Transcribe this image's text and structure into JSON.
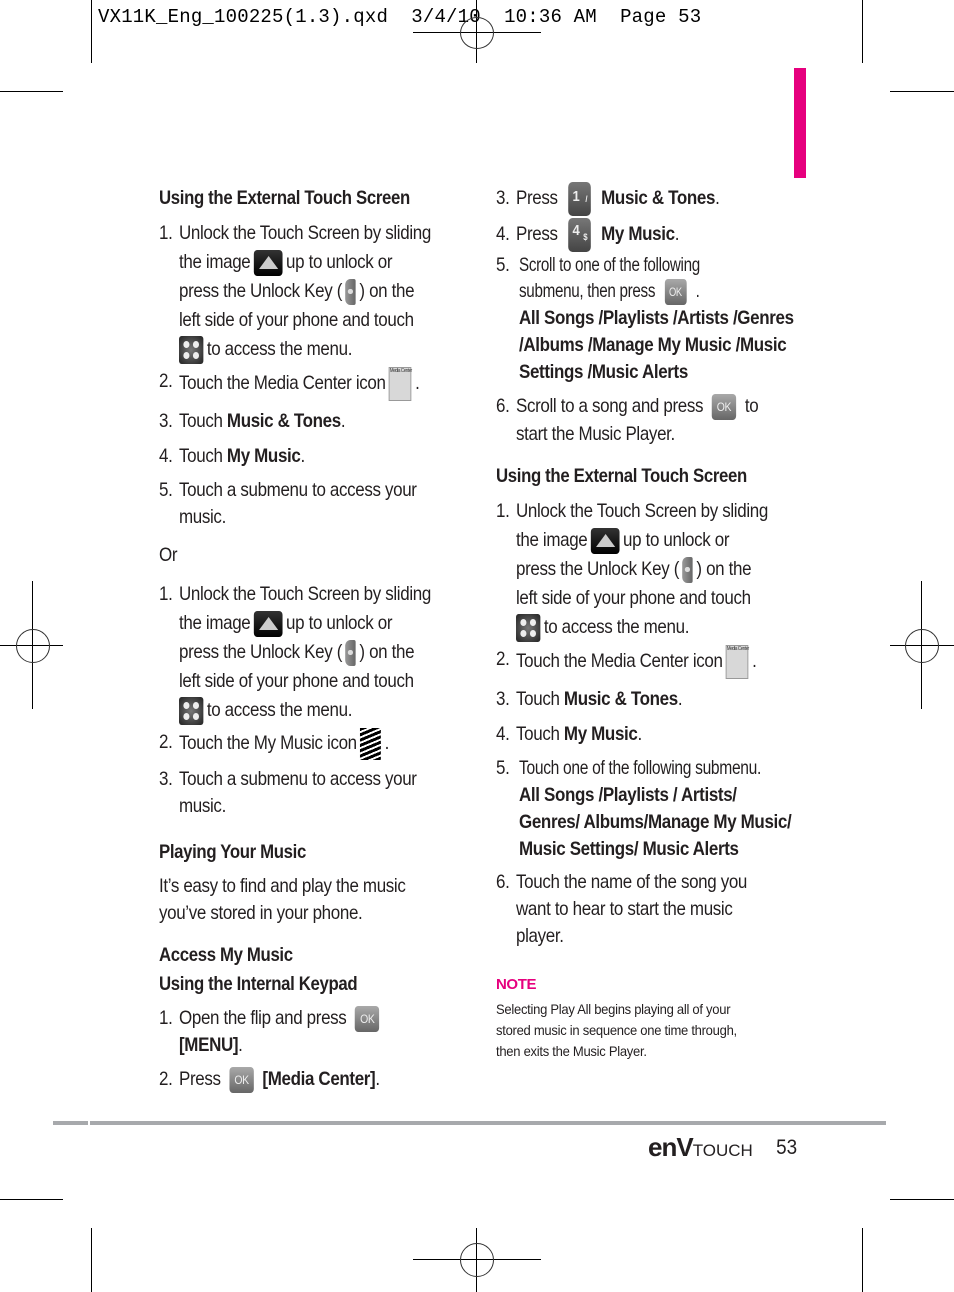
{
  "slug": "VX11K_Eng_100225(1.3).qxd  3/4/10  10:36 AM  Page 53",
  "colors": {
    "accent": "#e6007e",
    "rule": "#a7a9ac"
  },
  "left": {
    "h1": "Using the External Touch Screen",
    "s1": [
      {
        "n": "1.",
        "lines": [
          "Unlock the Touch Screen by sliding",
          "the image",
          "up to unlock or",
          "press the Unlock Key (",
          ") on the",
          "left side of your phone and touch",
          "to access the menu."
        ]
      },
      {
        "n": "2.",
        "pre": "Touch the Media Center icon",
        "post": "."
      },
      {
        "n": "3.",
        "pre": "Touch ",
        "bold": "Music & Tones",
        "post": "."
      },
      {
        "n": "4.",
        "pre": "Touch ",
        "bold": "My Music",
        "post": "."
      },
      {
        "n": "5.",
        "lines": [
          "Touch a submenu to access your",
          "music."
        ]
      }
    ],
    "or": "Or",
    "s2": [
      {
        "n": "1.",
        "lines": [
          "Unlock the Touch Screen by sliding",
          "the image",
          "up to unlock or",
          "press the Unlock Key (",
          ") on the",
          "left side of your phone and touch",
          "to access the menu."
        ]
      },
      {
        "n": "2.",
        "pre": "Touch the My Music icon",
        "post": "."
      },
      {
        "n": "3.",
        "lines": [
          "Touch a submenu to access your",
          "music."
        ]
      }
    ],
    "h2": "Playing Your Music",
    "p1": [
      "It’s easy to find and play the music",
      "you’ve stored in your phone."
    ],
    "h3": "Access My Music",
    "h4": "Using the Internal Keypad",
    "s3": [
      {
        "n": "1.",
        "pre": "Open the flip and press",
        "bold2": "[MENU]",
        "post": "."
      },
      {
        "n": "2.",
        "pre": "Press",
        "bold": "[Media Center]",
        "post": "."
      }
    ]
  },
  "right": {
    "s1": [
      {
        "n": "3.",
        "pre": "Press",
        "key": "1",
        "keysup": "/",
        "bold": "Music & Tones",
        "post": "."
      },
      {
        "n": "4.",
        "pre": "Press",
        "key": "4",
        "keysup": "$",
        "bold": "My Music",
        "post": "."
      },
      {
        "n": "5.",
        "lines": [
          "Scroll to one of the following",
          "submenu, then press",
          "."
        ],
        "bold": "All Songs /Playlists /Artists /Genres /Albums /Manage My Music /Music Settings /Music Alerts"
      },
      {
        "n": "6.",
        "lines": [
          "Scroll to a song and press",
          "to",
          "start the Music Player."
        ]
      }
    ],
    "h1": "Using the External Touch Screen",
    "s2": [
      {
        "n": "1.",
        "lines": [
          "Unlock the Touch Screen by sliding",
          "the image",
          "up to unlock or",
          "press the Unlock Key (",
          ") on the",
          "left side of your phone and touch",
          "to access the menu."
        ]
      },
      {
        "n": "2.",
        "pre": "Touch the Media Center icon",
        "post": "."
      },
      {
        "n": "3.",
        "pre": "Touch ",
        "bold": "Music & Tones",
        "post": "."
      },
      {
        "n": "4.",
        "pre": "Touch ",
        "bold": "My Music",
        "post": "."
      },
      {
        "n": "5.",
        "line": "Touch one of the following submenu.",
        "bold": "All Songs /Playlists / Artists/ Genres/ Albums/Manage My Music/ Music Settings/ Music Alerts"
      },
      {
        "n": "6.",
        "lines": [
          "Touch the name of the song you",
          "want to hear to start the music",
          "player."
        ]
      }
    ],
    "note_title": "NOTE",
    "note_lines": [
      "Selecting Play All begins playing all of your",
      "stored music in sequence one time through,",
      "then exits the Music Player."
    ]
  },
  "icons": {
    "ok": "OK",
    "media_center": "Media Center",
    "my_music": "MyMusic"
  },
  "footer": {
    "brand_env": "enV",
    "brand_touch": "TOUCH",
    "page": "53"
  }
}
